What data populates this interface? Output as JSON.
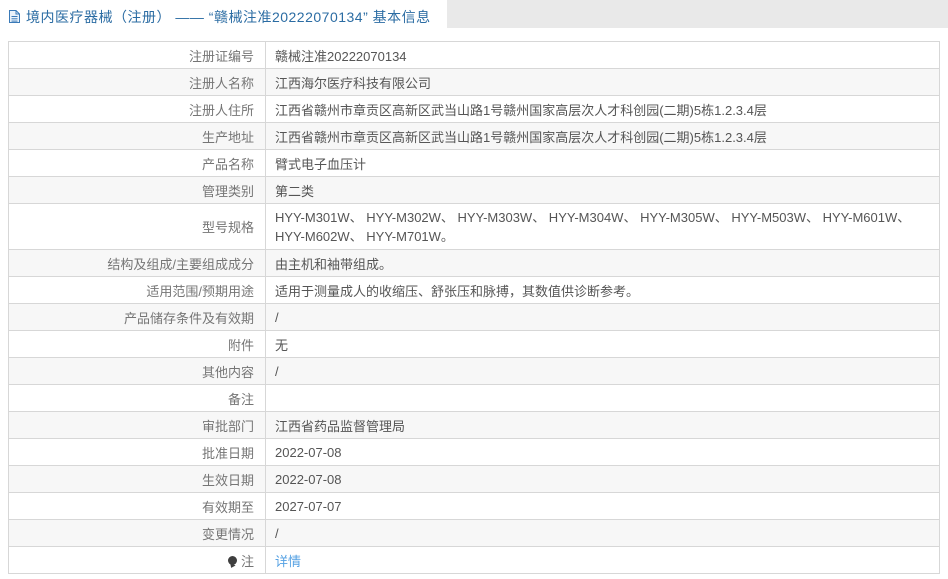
{
  "colors": {
    "title_blue": "#2b6ca3",
    "link_blue": "#55a1e3",
    "header_band_gray": "#e9e9e9",
    "row_alt_gray": "#f7f7f7",
    "border_gray": "#d7d7d7"
  },
  "header": {
    "doc_icon": "document-icon",
    "title": "境内医疗器械（注册） —— “赣械注准20222070134” 基本信息"
  },
  "registration": {
    "rows": [
      {
        "label": "注册证编号",
        "value": "赣械注准20222070134"
      },
      {
        "label": "注册人名称",
        "value": "江西海尔医疗科技有限公司"
      },
      {
        "label": "注册人住所",
        "value": "江西省赣州市章贡区高新区武当山路1号赣州国家高层次人才科创园(二期)5栋1.2.3.4层"
      },
      {
        "label": "生产地址",
        "value": "江西省赣州市章贡区高新区武当山路1号赣州国家高层次人才科创园(二期)5栋1.2.3.4层"
      },
      {
        "label": "产品名称",
        "value": "臂式电子血压计"
      },
      {
        "label": "管理类别",
        "value": "第二类"
      },
      {
        "label": "型号规格",
        "value": "HYY-M301W、 HYY-M302W、 HYY-M303W、 HYY-M304W、 HYY-M305W、 HYY-M503W、 HYY-M601W、 HYY-M602W、 HYY-M701W。"
      },
      {
        "label": "结构及组成/主要组成成分",
        "value": "由主机和袖带组成。"
      },
      {
        "label": "适用范围/预期用途",
        "value": "适用于测量成人的收缩压、舒张压和脉搏，其数值供诊断参考。"
      },
      {
        "label": "产品储存条件及有效期",
        "value": "/"
      },
      {
        "label": "附件",
        "value": "无"
      },
      {
        "label": "其他内容",
        "value": "/"
      },
      {
        "label": "备注",
        "value": ""
      },
      {
        "label": "审批部门",
        "value": "江西省药品监督管理局"
      },
      {
        "label": "批准日期",
        "value": "2022-07-08"
      },
      {
        "label": "生效日期",
        "value": "2022-07-08"
      },
      {
        "label": "有效期至",
        "value": "2027-07-07"
      },
      {
        "label": "变更情况",
        "value": "/"
      },
      {
        "label": "注",
        "value": "详情",
        "note_icon": "balloon-icon",
        "is_link": true
      }
    ]
  }
}
